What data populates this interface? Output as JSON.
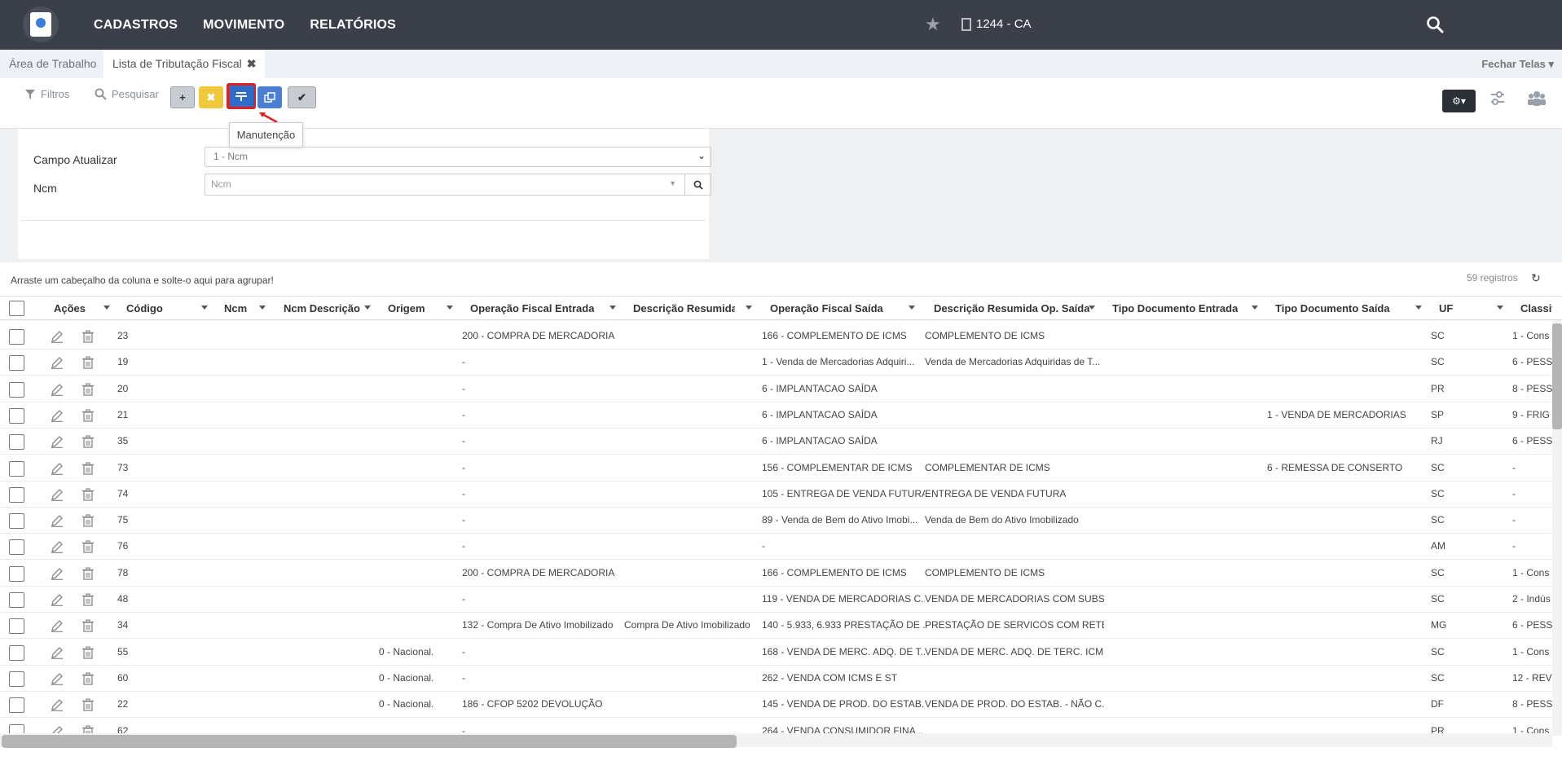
{
  "nav": {
    "items": [
      "CADASTROS",
      "MOVIMENTO",
      "RELATÓRIOS"
    ],
    "company": "1244 - CA"
  },
  "tabs": {
    "workspace": "Área de Trabalho",
    "active": "Lista de Tributação Fiscal",
    "close": "✖",
    "fechar": "Fechar Telas"
  },
  "toolbar": {
    "filters": "Filtros",
    "search": "Pesquisar",
    "tooltip": "Manutenção",
    "colors": {
      "yellow": "#f0c93a",
      "blue": "#2f6bc9",
      "highlight": "#e02020"
    }
  },
  "form": {
    "campo_label": "Campo Atualizar",
    "campo_value": "1 - Ncm",
    "ncm_label": "Ncm",
    "ncm_placeholder": "Ncm"
  },
  "grid": {
    "group_hint": "Arraste um cabeçalho da coluna e solte-o aqui para agrupar!",
    "count": "59 registros",
    "headers": [
      "Ações",
      "Código",
      "Ncm",
      "Ncm Descrição",
      "Origem",
      "Operação Fiscal Entrada",
      "Descrição Resumida...",
      "Operação Fiscal Saída",
      "Descrição Resumida Op. Saída",
      "Tipo Documento Entrada",
      "Tipo Documento Saída",
      "UF",
      "Classifica"
    ],
    "rows": [
      {
        "codigo": "23",
        "origem": "",
        "op_entrada": "200 - COMPRA DE MERCADORIA ...",
        "desc_entrada": "",
        "op_saida": "166 - COMPLEMENTO DE ICMS",
        "desc_saida": "COMPLEMENTO DE ICMS",
        "tipo_saida": "",
        "uf": "SC",
        "classif": "1 - Cons"
      },
      {
        "codigo": "19",
        "origem": "",
        "op_entrada": "-",
        "desc_entrada": "",
        "op_saida": "1 - Venda de Mercadorias Adquiri...",
        "desc_saida": "Venda de Mercadorias Adquiridas de T...",
        "tipo_saida": "",
        "uf": "SC",
        "classif": "6 - PESS"
      },
      {
        "codigo": "20",
        "origem": "",
        "op_entrada": "-",
        "desc_entrada": "",
        "op_saida": "6 - IMPLANTACAO SAÍDA",
        "desc_saida": "",
        "tipo_saida": "",
        "uf": "PR",
        "classif": "8 - PESS"
      },
      {
        "codigo": "21",
        "origem": "",
        "op_entrada": "-",
        "desc_entrada": "",
        "op_saida": "6 - IMPLANTACAO SAÍDA",
        "desc_saida": "",
        "tipo_saida": "1 - VENDA DE MERCADORIAS",
        "uf": "SP",
        "classif": "9 - FRIG"
      },
      {
        "codigo": "35",
        "origem": "",
        "op_entrada": "-",
        "desc_entrada": "",
        "op_saida": "6 - IMPLANTACAO SAÍDA",
        "desc_saida": "",
        "tipo_saida": "",
        "uf": "RJ",
        "classif": "6 - PESS"
      },
      {
        "codigo": "73",
        "origem": "",
        "op_entrada": "-",
        "desc_entrada": "",
        "op_saida": "156 - COMPLEMENTAR DE ICMS",
        "desc_saida": "COMPLEMENTAR DE ICMS",
        "tipo_saida": "6 - REMESSA DE CONSERTO",
        "uf": "SC",
        "classif": "-"
      },
      {
        "codigo": "74",
        "origem": "",
        "op_entrada": "-",
        "desc_entrada": "",
        "op_saida": "105 - ENTREGA DE VENDA FUTURA",
        "desc_saida": "ENTREGA DE VENDA FUTURA",
        "tipo_saida": "",
        "uf": "SC",
        "classif": "-"
      },
      {
        "codigo": "75",
        "origem": "",
        "op_entrada": "-",
        "desc_entrada": "",
        "op_saida": "89 - Venda de Bem do Ativo Imobi...",
        "desc_saida": "Venda de Bem do Ativo Imobilizado",
        "tipo_saida": "",
        "uf": "SC",
        "classif": "-"
      },
      {
        "codigo": "76",
        "origem": "",
        "op_entrada": "-",
        "desc_entrada": "",
        "op_saida": "-",
        "desc_saida": "",
        "tipo_saida": "",
        "uf": "AM",
        "classif": "-"
      },
      {
        "codigo": "78",
        "origem": "",
        "op_entrada": "200 - COMPRA DE MERCADORIA ...",
        "desc_entrada": "",
        "op_saida": "166 - COMPLEMENTO DE ICMS",
        "desc_saida": "COMPLEMENTO DE ICMS",
        "tipo_saida": "",
        "uf": "SC",
        "classif": "1 - Cons"
      },
      {
        "codigo": "48",
        "origem": "",
        "op_entrada": "-",
        "desc_entrada": "",
        "op_saida": "119 - VENDA DE MERCADORIAS C...",
        "desc_saida": "VENDA DE MERCADORIAS COM SUBS...",
        "tipo_saida": "",
        "uf": "SC",
        "classif": "2 - Indús"
      },
      {
        "codigo": "34",
        "origem": "",
        "op_entrada": "132 - Compra De Ativo Imobilizado",
        "desc_entrada": "Compra De Ativo Imobilizado",
        "op_saida": "140 - 5.933, 6.933 PRESTAÇÃO DE ...",
        "desc_saida": "PRESTAÇÃO DE SERVICOS COM RETE...",
        "tipo_saida": "",
        "uf": "MG",
        "classif": "6 - PESS"
      },
      {
        "codigo": "55",
        "origem": "0 - Nacional.",
        "op_entrada": "-",
        "desc_entrada": "",
        "op_saida": "168 - VENDA DE MERC. ADQ. DE T...",
        "desc_saida": "VENDA DE MERC. ADQ. DE TERC. ICM...",
        "tipo_saida": "",
        "uf": "SC",
        "classif": "1 - Cons"
      },
      {
        "codigo": "60",
        "origem": "0 - Nacional.",
        "op_entrada": "-",
        "desc_entrada": "",
        "op_saida": "262 - VENDA COM ICMS E ST",
        "desc_saida": "",
        "tipo_saida": "",
        "uf": "SC",
        "classif": "12 - REV"
      },
      {
        "codigo": "22",
        "origem": "0 - Nacional.",
        "op_entrada": "186 - CFOP 5202 DEVOLUÇÃO",
        "desc_entrada": "",
        "op_saida": "145 - VENDA DE PROD. DO ESTAB...",
        "desc_saida": "VENDA DE PROD. DO ESTAB. - NÃO C...",
        "tipo_saida": "",
        "uf": "DF",
        "classif": "8 - PESS"
      },
      {
        "codigo": "62",
        "origem": "",
        "op_entrada": "-",
        "desc_entrada": "",
        "op_saida": "264 - VENDA CONSUMIDOR FINA...",
        "desc_saida": "",
        "tipo_saida": "",
        "uf": "PR",
        "classif": "1 - Cons"
      }
    ]
  }
}
